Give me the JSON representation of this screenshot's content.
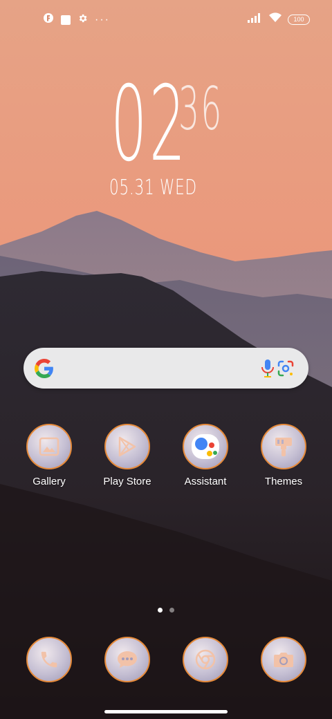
{
  "status_bar": {
    "battery_level": "100",
    "left_icons": [
      "notification-f-icon",
      "square-notification-icon",
      "gear-icon",
      "more-dots-icon"
    ],
    "right_icons": [
      "signal-icon",
      "wifi-icon",
      "battery-icon"
    ],
    "overflow": "···"
  },
  "clock": {
    "hour": "02",
    "minute": "36",
    "date": "05.31 WED"
  },
  "search_bar": {
    "placeholder": "",
    "icons": [
      "google-g-icon",
      "microphone-icon",
      "google-lens-icon"
    ]
  },
  "apps": [
    {
      "label": "Gallery",
      "icon": "gallery-icon"
    },
    {
      "label": "Play Store",
      "icon": "play-store-icon"
    },
    {
      "label": "Assistant",
      "icon": "assistant-icon"
    },
    {
      "label": "Themes",
      "icon": "themes-brush-icon"
    }
  ],
  "pager": {
    "total_pages": 2,
    "current_page": 1
  },
  "dock": [
    {
      "icon": "phone-icon"
    },
    {
      "icon": "messages-icon"
    },
    {
      "icon": "chrome-icon"
    },
    {
      "icon": "camera-icon"
    }
  ],
  "colors": {
    "sky": "#e9967a",
    "accent_ring": "#e68a3a",
    "icon_glyph": "#f2c2a8"
  }
}
